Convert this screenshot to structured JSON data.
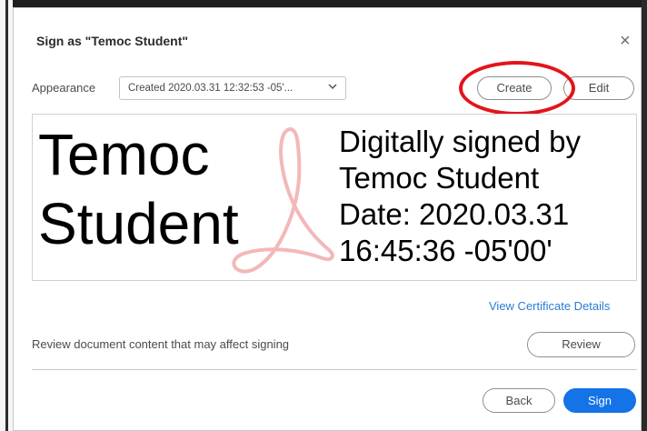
{
  "dialog": {
    "title": "Sign as \"Temoc Student\"",
    "close_glyph": "×"
  },
  "appearance": {
    "label": "Appearance",
    "selected": "Created 2020.03.31 12:32:53 -05'...",
    "chevron_glyph": "⌄"
  },
  "buttons": {
    "create": "Create",
    "edit": "Edit",
    "review": "Review",
    "back": "Back",
    "sign": "Sign"
  },
  "signature_preview": {
    "name_lines": [
      "Temoc",
      "Student"
    ],
    "detail_lines": [
      "Digitally signed by",
      "Temoc Student",
      "Date: 2020.03.31",
      "16:45:36 -05'00'"
    ]
  },
  "links": {
    "view_certificate": "View Certificate Details"
  },
  "review": {
    "text": "Review document content that may affect signing"
  },
  "colors": {
    "primary": "#1473e6",
    "link": "#2d7bd4",
    "highlight": "#e3141b",
    "watermark": "#f3b8b8"
  },
  "icons": {
    "close": "close-icon",
    "dropdown": "chevron-down-icon",
    "watermark": "acrobat-logo-icon"
  }
}
